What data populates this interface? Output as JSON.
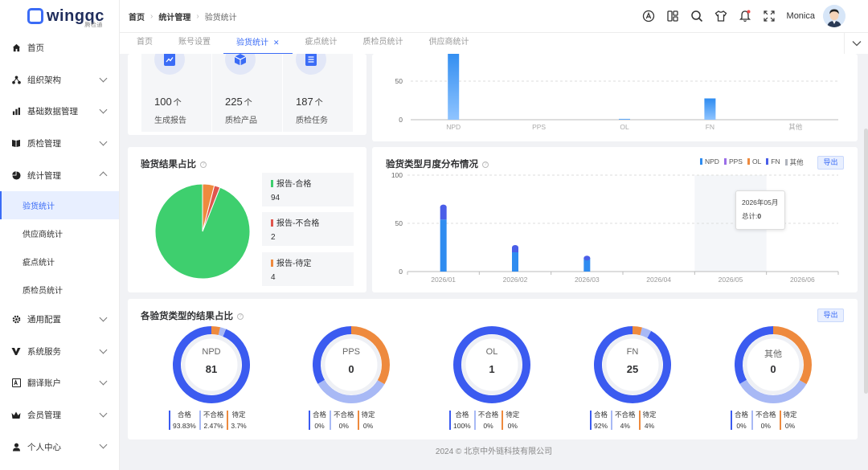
{
  "app": {
    "logo_text": "wingqc",
    "logo_sub": "腾检通",
    "user_name": "Monica"
  },
  "sidebar": {
    "items": [
      {
        "label": "首页",
        "icon": "home-icon"
      },
      {
        "label": "组织架构",
        "icon": "org-icon"
      },
      {
        "label": "基础数据管理",
        "icon": "chart-bar-icon"
      },
      {
        "label": "质检管理",
        "icon": "book-icon"
      },
      {
        "label": "统计管理",
        "icon": "pie-icon"
      },
      {
        "label": "通用配置",
        "icon": "gear-icon"
      },
      {
        "label": "系统服务",
        "icon": "service-icon"
      },
      {
        "label": "翻译账户",
        "icon": "translate-icon"
      },
      {
        "label": "会员管理",
        "icon": "crown-icon"
      },
      {
        "label": "个人中心",
        "icon": "user-icon"
      }
    ],
    "sub_items": [
      "验货统计",
      "供应商统计",
      "疵点统计",
      "质检员统计"
    ]
  },
  "breadcrumb": [
    "首页",
    "统计管理",
    "验货统计"
  ],
  "tabs": [
    "首页",
    "账号设置",
    "验货统计",
    "疵点统计",
    "质检员统计",
    "供应商统计"
  ],
  "stats": [
    {
      "value": "100",
      "unit": "个",
      "label": "生成报告"
    },
    {
      "value": "225",
      "unit": "个",
      "label": "质检产品"
    },
    {
      "value": "187",
      "unit": "个",
      "label": "质检任务"
    }
  ],
  "top_chart": {
    "categories": [
      "NPD",
      "PPS",
      "OL",
      "FN",
      "其他"
    ],
    "values": [
      81,
      0,
      1,
      25,
      0
    ],
    "ytick_labels": [
      "50",
      "0"
    ]
  },
  "result_ratio": {
    "title": "验货结果占比",
    "items": [
      {
        "label": "报告-合格",
        "value": "94",
        "color": "#3ecf6e"
      },
      {
        "label": "报告-不合格",
        "value": "2",
        "color": "#e0564e"
      },
      {
        "label": "报告-待定",
        "value": "4",
        "color": "#ee8a3e"
      }
    ]
  },
  "monthly": {
    "title": "验货类型月度分布情况",
    "export": "导出",
    "legend": [
      {
        "name": "NPD",
        "color": "#2f8cf0"
      },
      {
        "name": "PPS",
        "color": "#9b6ee8"
      },
      {
        "name": "OL",
        "color": "#ee8a3e"
      },
      {
        "name": "FN",
        "color": "#4a5ee8"
      },
      {
        "name": "其他",
        "color": "#b0b4bd"
      }
    ],
    "ytick_labels": [
      "100",
      "50",
      "0"
    ],
    "months": [
      "2026/01",
      "2026/02",
      "2026/03",
      "2026/04",
      "2026/05",
      "2026/06"
    ],
    "totals": [
      67,
      25,
      14,
      0,
      0,
      0
    ],
    "tooltip_title": "2026年05月",
    "tooltip_label": "总计:",
    "tooltip_value": "0"
  },
  "type_results": {
    "title": "各验货类型的结果占比",
    "export": "导出",
    "legend_labels": [
      "合格",
      "不合格",
      "待定"
    ],
    "types": [
      {
        "name": "NPD",
        "total": "81",
        "pcts": [
          "93.83%",
          "2.47%",
          "3.7%"
        ]
      },
      {
        "name": "PPS",
        "total": "0",
        "pcts": [
          "0%",
          "0%",
          "0%"
        ]
      },
      {
        "name": "OL",
        "total": "1",
        "pcts": [
          "100%",
          "0%",
          "0%"
        ]
      },
      {
        "name": "FN",
        "total": "25",
        "pcts": [
          "92%",
          "4%",
          "4%"
        ]
      },
      {
        "name": "其他",
        "total": "0",
        "pcts": [
          "0%",
          "0%",
          "0%"
        ]
      }
    ]
  },
  "chart_data": [
    {
      "type": "bar",
      "categories": [
        "NPD",
        "PPS",
        "OL",
        "FN",
        "其他"
      ],
      "values": [
        81,
        0,
        1,
        25,
        0
      ]
    },
    {
      "type": "pie",
      "title": "验货结果占比",
      "labels": [
        "报告-合格",
        "报告-不合格",
        "报告-待定"
      ],
      "values": [
        94,
        2,
        4
      ]
    },
    {
      "type": "bar",
      "title": "验货类型月度分布情况",
      "categories": [
        "2026/01",
        "2026/02",
        "2026/03",
        "2026/04",
        "2026/05",
        "2026/06"
      ],
      "series": [
        {
          "name": "NPD",
          "values": [
            54,
            20,
            14,
            0,
            0,
            0
          ]
        },
        {
          "name": "PPS",
          "values": [
            0,
            0,
            0,
            0,
            0,
            0
          ]
        },
        {
          "name": "OL",
          "values": [
            0,
            0,
            0,
            0,
            0,
            0
          ]
        },
        {
          "name": "FN",
          "values": [
            13,
            5,
            0,
            0,
            0,
            0
          ]
        },
        {
          "name": "其他",
          "values": [
            0,
            0,
            0,
            0,
            0,
            0
          ]
        }
      ],
      "ylim": [
        0,
        100
      ]
    },
    {
      "type": "pie",
      "title": "各验货类型的结果占比",
      "categories": [
        "NPD",
        "PPS",
        "OL",
        "FN",
        "其他"
      ],
      "series": [
        {
          "name": "合格",
          "values": [
            93.83,
            0,
            100,
            92,
            0
          ]
        },
        {
          "name": "不合格",
          "values": [
            2.47,
            0,
            0,
            4,
            0
          ]
        },
        {
          "name": "待定",
          "values": [
            3.7,
            0,
            0,
            4,
            0
          ]
        }
      ]
    }
  ],
  "footer": "2024 © 北京中外链科技有限公司"
}
